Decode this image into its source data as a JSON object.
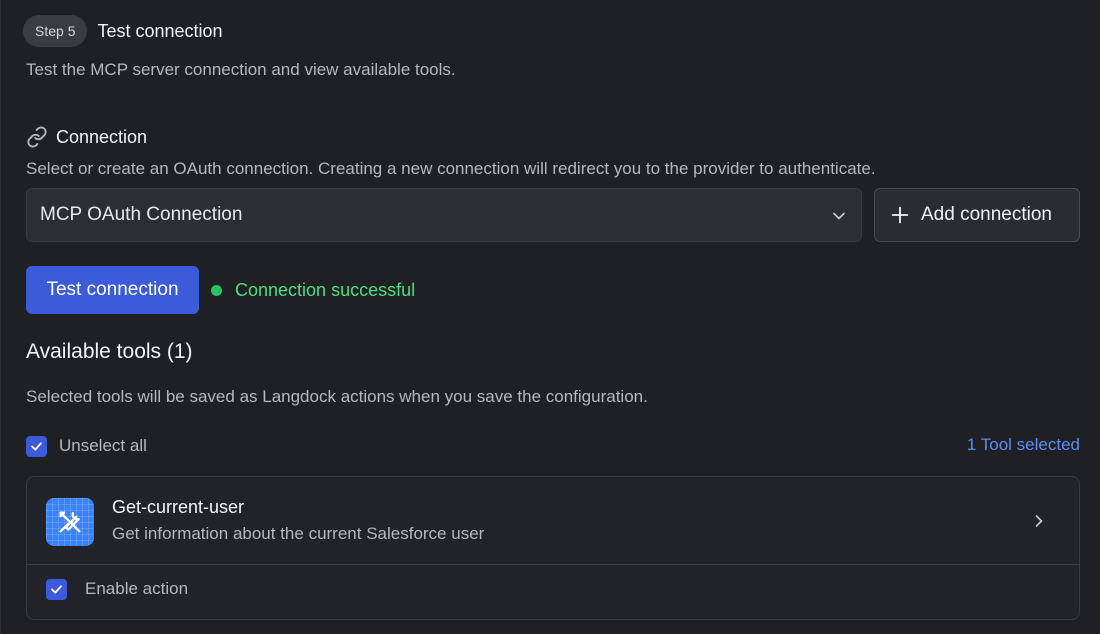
{
  "step": {
    "badge": "Step 5",
    "title": "Test connection",
    "description": "Test the MCP server connection and view available tools."
  },
  "connection": {
    "icon": "link-icon",
    "title": "Connection",
    "description": "Select or create an OAuth connection. Creating a new connection will redirect you to the provider to authenticate.",
    "selected_value": "MCP OAuth Connection",
    "add_label": "Add connection"
  },
  "test": {
    "button_label": "Test connection",
    "status_text": "Connection successful",
    "status_color": "#22c55e"
  },
  "tools": {
    "title": "Available tools (1)",
    "description": "Selected tools will be saved as Langdock actions when you save the configuration.",
    "unselect_label": "Unselect all",
    "selected_count": "1 Tool selected",
    "items": [
      {
        "name": "Get-current-user",
        "description": "Get information about the current Salesforce user",
        "icon": "tools-icon",
        "enable_label": "Enable action",
        "enabled": true
      }
    ]
  },
  "colors": {
    "background": "#1f2024",
    "accent": "#3b5bdb",
    "link": "#5b8def",
    "success": "#4ade80"
  }
}
